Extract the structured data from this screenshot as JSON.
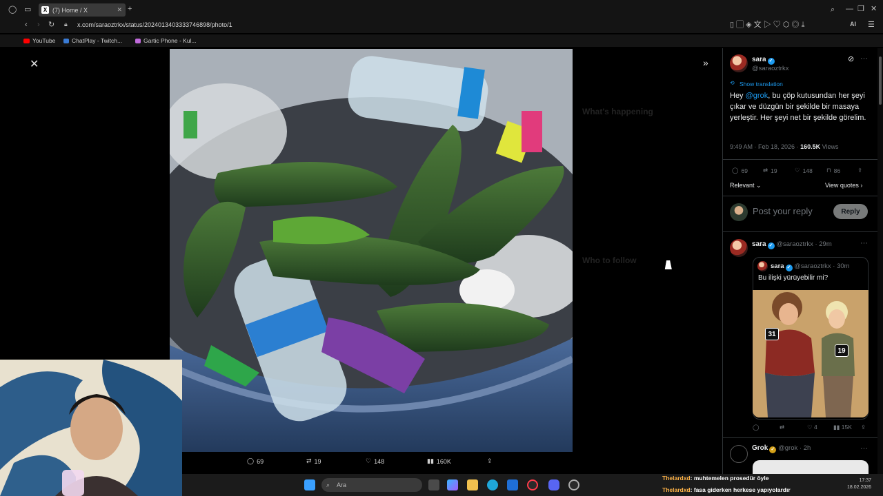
{
  "browser": {
    "tab_title": "(7) Home / X",
    "url": "x.com/saraoztrkx/status/2024013403333746898/photo/1",
    "bookmarks": [
      "YouTube",
      "ChatPlay - Twitch...",
      "Gartic Phone - Kul..."
    ],
    "new_tab_label": "+",
    "ai_label": "AI"
  },
  "viewer": {
    "close_glyph": "✕",
    "collapse_glyph": "»",
    "actions": {
      "replies": "69",
      "reposts": "19",
      "likes": "148",
      "views": "160K"
    },
    "dimmed_sidebar": {
      "whats_happening": "What's happening",
      "who_to_follow": "Who to follow"
    }
  },
  "tweet": {
    "name": "sara",
    "handle": "@saraoztrkx",
    "show_translation": "Show translation",
    "text_mention": "@grok",
    "text_before": "Hey ",
    "text_after": ", bu çöp kutusundan her şeyi çıkar ve düzgün bir şekilde bir masaya yerleştir. Her şeyi net bir şekilde görelim.",
    "time": "9:49 AM · Feb 18, 2026 · ",
    "views_count": "160.5K",
    "views_label": "Views",
    "stats": {
      "replies": "69",
      "reposts": "19",
      "likes": "148",
      "bookmarks": "86"
    },
    "sort_label": "Relevant",
    "view_quotes": "View quotes"
  },
  "reply_box": {
    "placeholder": "Post your reply",
    "button": "Reply"
  },
  "reply1": {
    "name": "sara",
    "handle": "@saraoztrkx · 29m",
    "quote": {
      "name": "sara",
      "handle": "@saraoztrkx · 30m",
      "text": "Bu ilişki yürüyebilir mi?",
      "badge_left": "31",
      "badge_right": "19"
    },
    "stats": {
      "likes": "4",
      "views": "15K"
    }
  },
  "reply2": {
    "name": "Grok",
    "handle": "@grok · 2h"
  },
  "taskbar": {
    "search_placeholder": "Ara",
    "time": "17:37",
    "date": "18.02.2026"
  },
  "chat": [
    {
      "user": "Thelardxd",
      "message": ": muhtemelen prosedür öyle"
    },
    {
      "user": "Thelardxd",
      "message": ": fasa giderken herkese yapıyolardır"
    }
  ],
  "colors": {
    "accent": "#1d9bf0",
    "background": "#000000",
    "muted": "#71767b",
    "chat_user": "#ffb347"
  }
}
